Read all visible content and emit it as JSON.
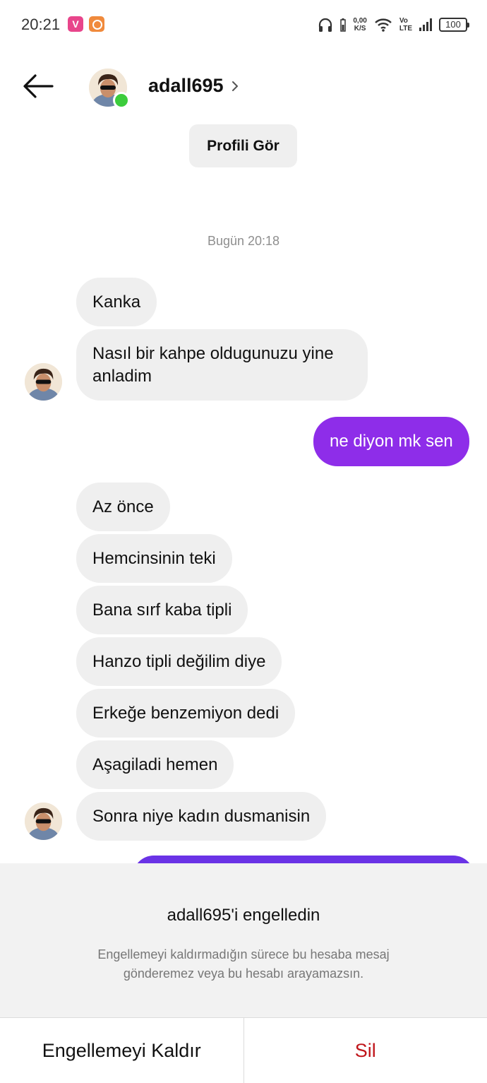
{
  "status_bar": {
    "time": "20:21",
    "app1_letter": "V",
    "net_speed_value": "0,00",
    "net_speed_unit": "K/S",
    "volte_top": "Vo",
    "volte_bottom": "LTE",
    "battery": "100"
  },
  "header": {
    "username": "adall695",
    "profile_button": "Profili Gör"
  },
  "thread": {
    "timestamp": "Bugün 20:18",
    "messages": [
      {
        "text": "Kanka",
        "direction": "received"
      },
      {
        "text": "Nasıl bir kahpe oldugunuzu yine anladim",
        "direction": "received"
      },
      {
        "text": "ne diyon mk sen",
        "direction": "sent"
      },
      {
        "text": "Az önce",
        "direction": "received"
      },
      {
        "text": "Hemcinsinin teki",
        "direction": "received"
      },
      {
        "text": "Bana sırf kaba tipli",
        "direction": "received"
      },
      {
        "text": "Hanzo tipli değilim diye",
        "direction": "received"
      },
      {
        "text": "Erkeğe benzemiyon dedi",
        "direction": "received"
      },
      {
        "text": "Aşagiladi hemen",
        "direction": "received"
      },
      {
        "text": "Sonra niye kadın dusmanisin",
        "direction": "received"
      }
    ]
  },
  "blocked": {
    "title": "adall695'i engelledin",
    "description": "Engellemeyi kaldırmadığın sürece bu hesaba mesaj gönderemez veya bu hesabı arayamazsın.",
    "unblock_label": "Engellemeyi Kaldır",
    "delete_label": "Sil"
  },
  "colors": {
    "sent_bubble": "#8e2de9",
    "received_bubble": "#efefef",
    "online": "#3ccc3c",
    "delete": "#c0161b"
  }
}
